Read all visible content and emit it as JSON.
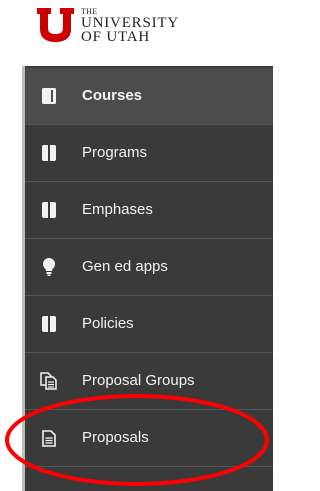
{
  "header": {
    "logo": {
      "line1": "THE",
      "line2": "UNIVERSITY",
      "line3": "OF UTAH",
      "brand_color": "#cc0000"
    }
  },
  "sidebar": {
    "items": [
      {
        "label": "Courses",
        "icon": "book-icon",
        "active": true
      },
      {
        "label": "Programs",
        "icon": "book-icon",
        "active": false
      },
      {
        "label": "Emphases",
        "icon": "book-icon",
        "active": false
      },
      {
        "label": "Gen ed apps",
        "icon": "lightbulb-icon",
        "active": false
      },
      {
        "label": "Policies",
        "icon": "book-icon",
        "active": false
      },
      {
        "label": "Proposal Groups",
        "icon": "documents-icon",
        "active": false
      },
      {
        "label": "Proposals",
        "icon": "document-icon",
        "active": false
      }
    ]
  },
  "annotation": {
    "color": "#ff0000",
    "shape": "ellipse",
    "target": "Proposals"
  }
}
